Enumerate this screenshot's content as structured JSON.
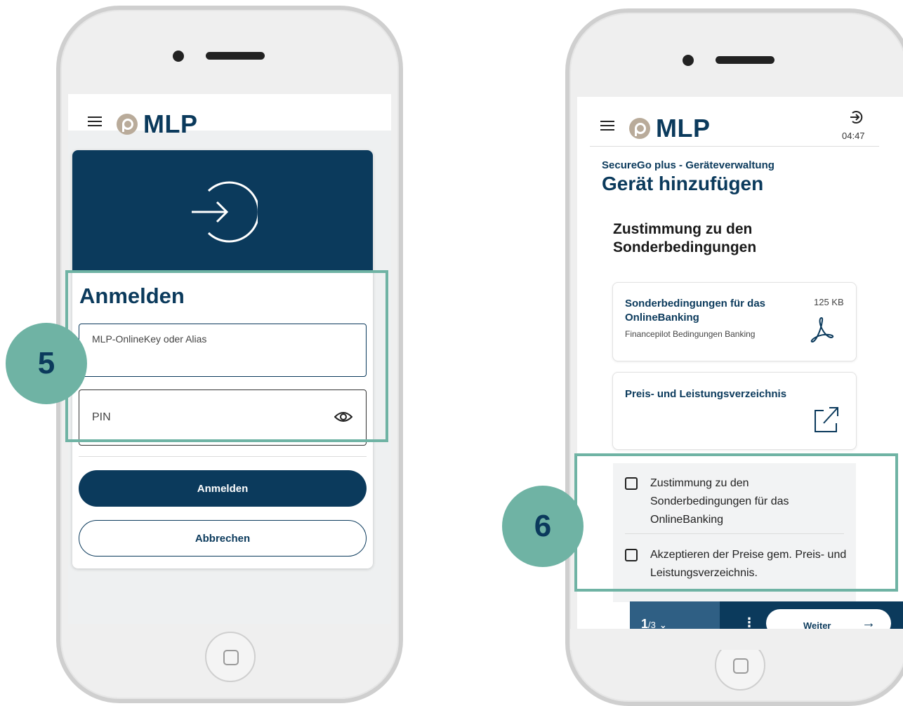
{
  "login_screen": {
    "brand": "MLP",
    "title": "Anmelden",
    "onlinekey_field": {
      "label": "MLP-OnlineKey oder Alias",
      "value": ""
    },
    "pin_field": {
      "placeholder": "PIN",
      "value": ""
    },
    "login_button": "Anmelden",
    "cancel_button": "Abbrechen",
    "step_badge": "5"
  },
  "consent_screen": {
    "brand": "MLP",
    "session_timer": "04:47",
    "breadcrumb": "SecureGo plus - Geräteverwaltung",
    "page_title": "Gerät hinzufügen",
    "section_title_line1": "Zustimmung zu den",
    "section_title_line2": "Sonderbedingungen",
    "documents": [
      {
        "title_line1": "Sonderbedingungen für das",
        "title_line2": "OnlineBanking",
        "subtitle": "Financepilot Bedingungen Banking",
        "size": "125 KB",
        "icon": "pdf-icon"
      },
      {
        "title_line1": "Preis- und Leistungsverzeichnis",
        "icon": "external-link-icon"
      }
    ],
    "checkboxes": [
      {
        "line1": "Zustimmung zu den",
        "line2": "Sonderbedingungen für das",
        "line3": "OnlineBanking",
        "checked": false
      },
      {
        "line1": "Akzeptieren der Preise gem. Preis- und",
        "line2": "Leistungsverzeichnis.",
        "checked": false
      }
    ],
    "pager": {
      "current": "1",
      "total": "/3"
    },
    "next_button": "Weiter",
    "step_badge": "6"
  }
}
